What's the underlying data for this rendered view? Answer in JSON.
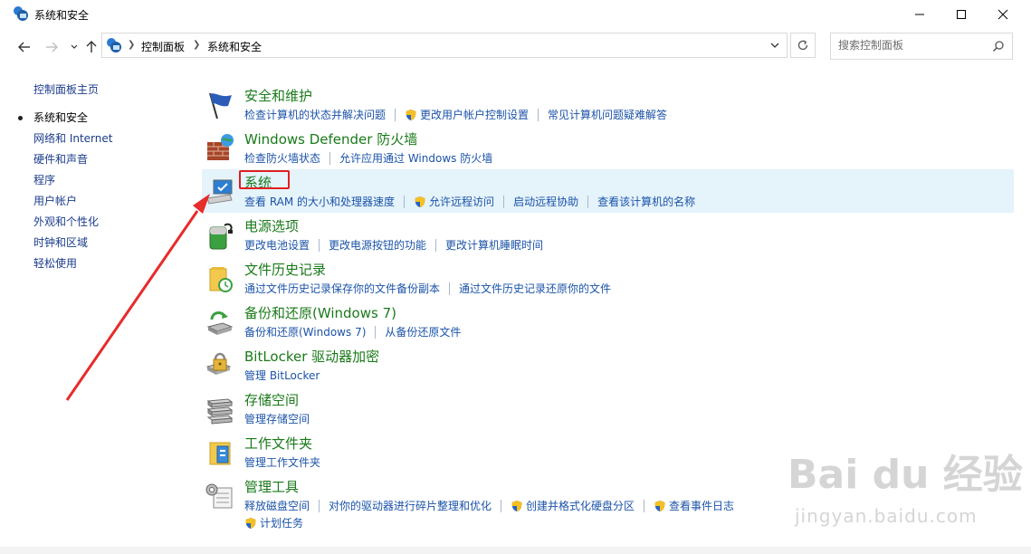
{
  "window": {
    "title": "系统和安全"
  },
  "address": {
    "crumbs": [
      "控制面板",
      "系统和安全"
    ]
  },
  "search": {
    "placeholder": "搜索控制面板"
  },
  "sidebar": {
    "home": "控制面板主页",
    "items": [
      {
        "label": "系统和安全",
        "current": true
      },
      {
        "label": "网络和 Internet"
      },
      {
        "label": "硬件和声音"
      },
      {
        "label": "程序"
      },
      {
        "label": "用户帐户"
      },
      {
        "label": "外观和个性化"
      },
      {
        "label": "时钟和区域"
      },
      {
        "label": "轻松使用"
      }
    ]
  },
  "categories": [
    {
      "title": "安全和维护",
      "icon": "flag-icon",
      "links": [
        {
          "label": "检查计算机的状态并解决问题",
          "shield": false
        },
        {
          "label": "更改用户帐户控制设置",
          "shield": true
        },
        {
          "label": "常见计算机问题疑难解答",
          "shield": false
        }
      ]
    },
    {
      "title": "Windows Defender 防火墙",
      "icon": "firewall-icon",
      "links": [
        {
          "label": "检查防火墙状态",
          "shield": false
        },
        {
          "label": "允许应用通过 Windows 防火墙",
          "shield": false
        }
      ]
    },
    {
      "title": "系统",
      "icon": "computer-icon",
      "highlight": true,
      "links": [
        {
          "label": "查看 RAM 的大小和处理器速度",
          "shield": false
        },
        {
          "label": "允许远程访问",
          "shield": true
        },
        {
          "label": "启动远程协助",
          "shield": false
        },
        {
          "label": "查看该计算机的名称",
          "shield": false
        }
      ]
    },
    {
      "title": "电源选项",
      "icon": "power-icon",
      "links": [
        {
          "label": "更改电池设置",
          "shield": false
        },
        {
          "label": "更改电源按钮的功能",
          "shield": false
        },
        {
          "label": "更改计算机睡眠时间",
          "shield": false
        }
      ]
    },
    {
      "title": "文件历史记录",
      "icon": "file-history-icon",
      "links": [
        {
          "label": "通过文件历史记录保存你的文件备份副本",
          "shield": false
        },
        {
          "label": "通过文件历史记录还原你的文件",
          "shield": false
        }
      ]
    },
    {
      "title": "备份和还原(Windows 7)",
      "icon": "backup-icon",
      "links": [
        {
          "label": "备份和还原(Windows 7)",
          "shield": false
        },
        {
          "label": "从备份还原文件",
          "shield": false
        }
      ]
    },
    {
      "title": "BitLocker 驱动器加密",
      "icon": "bitlocker-icon",
      "links": [
        {
          "label": "管理 BitLocker",
          "shield": false
        }
      ]
    },
    {
      "title": "存储空间",
      "icon": "storage-icon",
      "links": [
        {
          "label": "管理存储空间",
          "shield": false
        }
      ]
    },
    {
      "title": "工作文件夹",
      "icon": "work-folders-icon",
      "links": [
        {
          "label": "管理工作文件夹",
          "shield": false
        }
      ]
    },
    {
      "title": "管理工具",
      "icon": "admin-tools-icon",
      "links": [
        {
          "label": "释放磁盘空间",
          "shield": false
        },
        {
          "label": "对你的驱动器进行碎片整理和优化",
          "shield": false
        },
        {
          "label": "创建并格式化硬盘分区",
          "shield": true
        },
        {
          "label": "查看事件日志",
          "shield": true
        }
      ],
      "links2": [
        {
          "label": "计划任务",
          "shield": true
        }
      ]
    }
  ],
  "watermark": {
    "main": "Bai du 经验",
    "sub": "jingyan.baidu.com"
  },
  "colors": {
    "link": "#1b53a8",
    "category_title": "#1a7a1a",
    "highlight": "#e5f3fb",
    "annotation": "#e31e1e"
  }
}
